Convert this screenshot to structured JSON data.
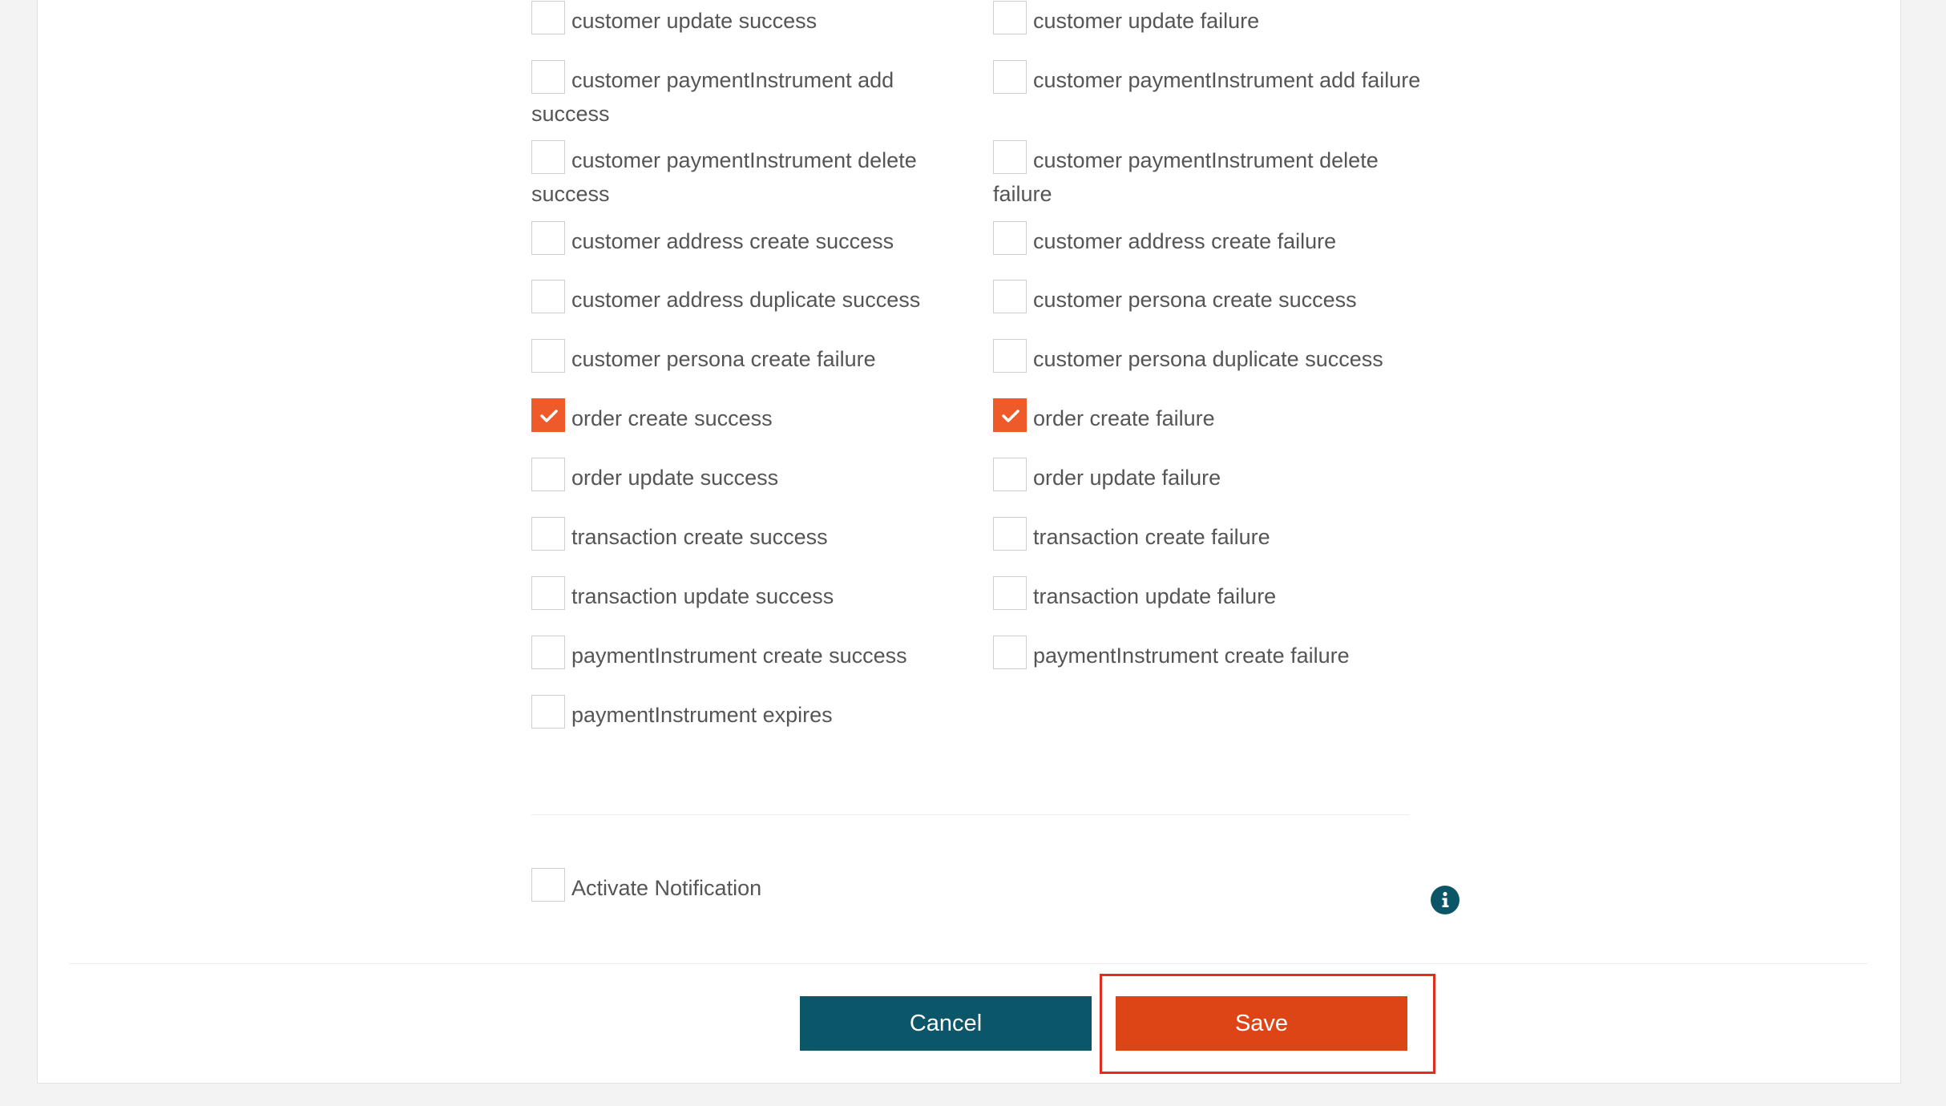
{
  "events": {
    "left": [
      {
        "label": "customer update success",
        "checked": false
      },
      {
        "label": "customer paymentInstrument add success",
        "checked": false
      },
      {
        "label": "customer paymentInstrument delete success",
        "checked": false
      },
      {
        "label": "customer address create success",
        "checked": false
      },
      {
        "label": "customer address duplicate success",
        "checked": false
      },
      {
        "label": "customer persona create failure",
        "checked": false
      },
      {
        "label": "order create success",
        "checked": true
      },
      {
        "label": "order update success",
        "checked": false
      },
      {
        "label": "transaction create success",
        "checked": false
      },
      {
        "label": "transaction update success",
        "checked": false
      },
      {
        "label": "paymentInstrument create success",
        "checked": false
      },
      {
        "label": "paymentInstrument expires",
        "checked": false
      }
    ],
    "right": [
      {
        "label": "customer update failure",
        "checked": false
      },
      {
        "label": "customer paymentInstrument add failure",
        "checked": false
      },
      {
        "label": "customer paymentInstrument delete failure",
        "checked": false
      },
      {
        "label": "customer address create failure",
        "checked": false
      },
      {
        "label": "customer persona create success",
        "checked": false
      },
      {
        "label": "customer persona duplicate success",
        "checked": false
      },
      {
        "label": "order create failure",
        "checked": true
      },
      {
        "label": "order update failure",
        "checked": false
      },
      {
        "label": "transaction create failure",
        "checked": false
      },
      {
        "label": "transaction update failure",
        "checked": false
      },
      {
        "label": "paymentInstrument create failure",
        "checked": false
      }
    ]
  },
  "activate": {
    "label": "Activate Notification",
    "checked": false
  },
  "info": {
    "icon": "info-icon"
  },
  "buttons": {
    "cancel_label": "Cancel",
    "save_label": "Save"
  },
  "colors": {
    "accent_orange": "#ee5a2a",
    "save_button": "#dd4516",
    "cancel_button": "#0c566a",
    "highlight": "#e32b1e"
  }
}
